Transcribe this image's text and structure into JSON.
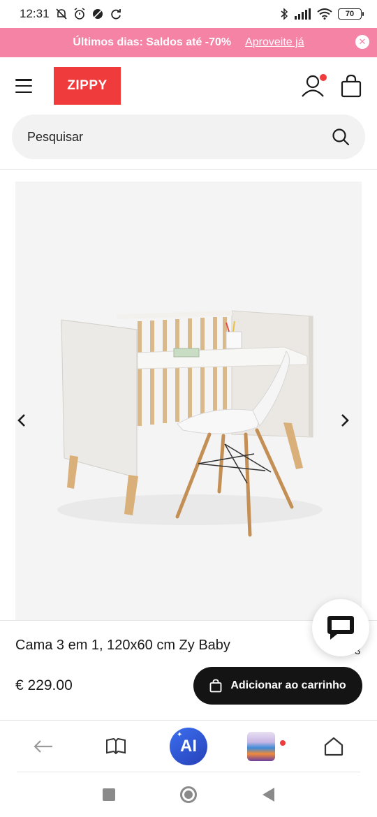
{
  "status_bar": {
    "time": "12:31",
    "battery": "70"
  },
  "promo": {
    "text": "Últimos dias: Saldos até -70%",
    "link": "Aproveite já",
    "background_color": "#f583a6"
  },
  "header": {
    "logo_text": "ZIPPY",
    "logo_color": "#ef3b3b",
    "icons": [
      "menu-icon",
      "user-icon",
      "shopping-bag-icon"
    ]
  },
  "search": {
    "placeholder": "Pesquisar"
  },
  "product": {
    "name": "Cama 3 em 1, 120x60 cm Zy Baby",
    "price": "€ 229.00",
    "add_to_cart_label": "Adicionar ao carrinho",
    "partial_text": "3"
  },
  "browser_nav": {
    "ai_label": "AI",
    "icons": [
      "back-arrow-icon",
      "reading-mode-icon",
      "ai-assistant-icon",
      "tabs-thumbnail-icon",
      "home-icon"
    ]
  },
  "system_nav": {
    "icons": [
      "recents-square-icon",
      "home-circle-icon",
      "back-triangle-icon"
    ]
  }
}
